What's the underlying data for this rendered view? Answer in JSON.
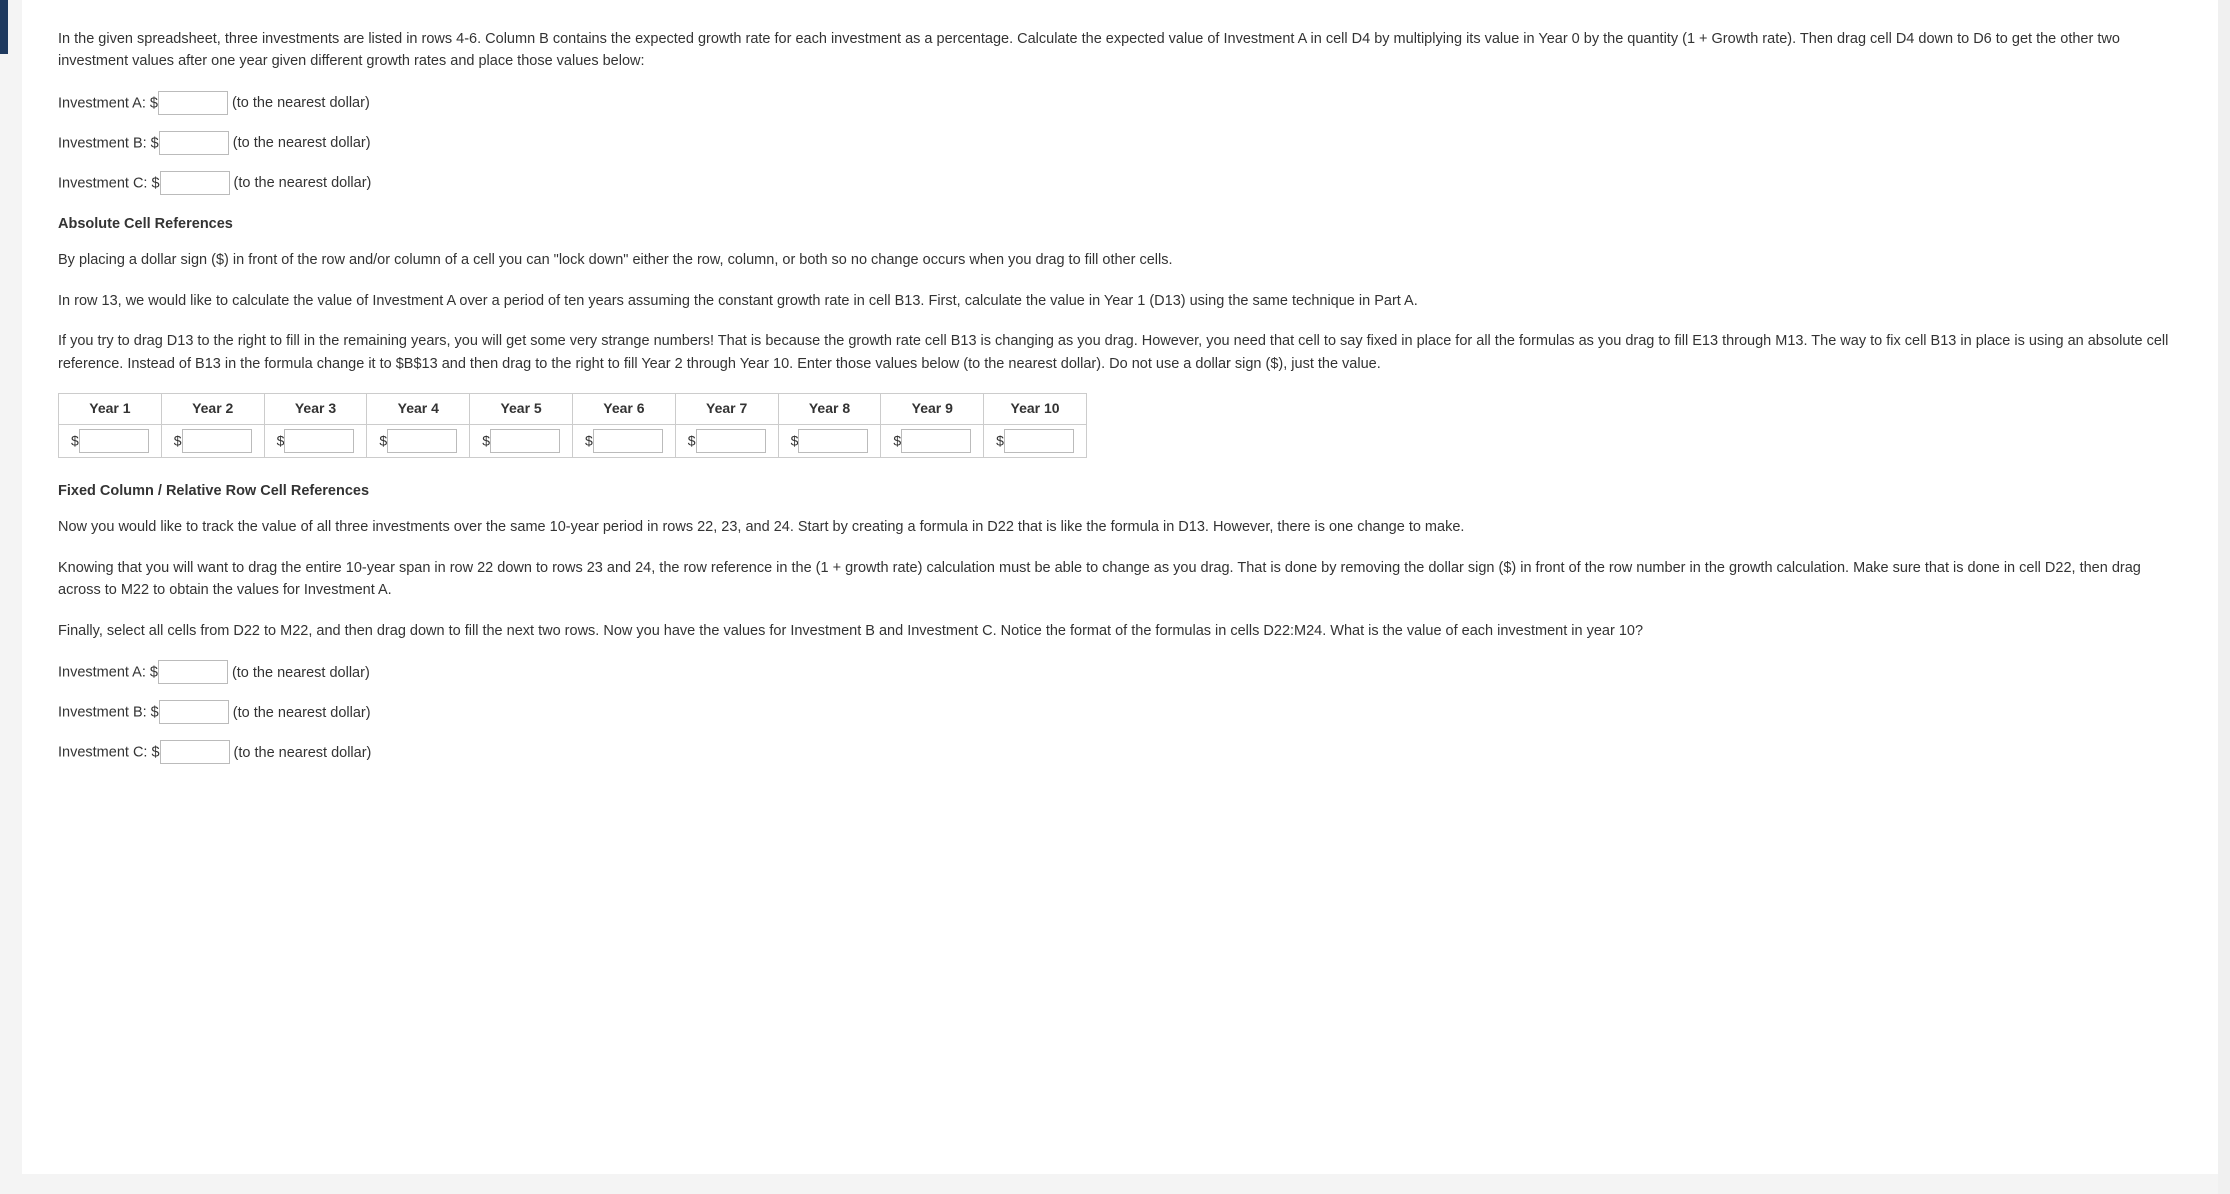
{
  "intro": "In the given spreadsheet, three investments are listed in rows 4-6. Column B contains the expected growth rate for each investment as a percentage. Calculate the expected value of Investment A in cell D4 by multiplying its value in Year 0 by the quantity (1 + Growth rate). Then drag cell D4 down to D6 to get the other two investment values after one year given different growth rates and place those values below:",
  "investments1": {
    "a": {
      "label": "Investment A: $",
      "suffix": "(to the nearest dollar)"
    },
    "b": {
      "label": "Investment B: $",
      "suffix": "(to the nearest dollar)"
    },
    "c": {
      "label": "Investment C: $",
      "suffix": "(to the nearest dollar)"
    }
  },
  "section_abs": {
    "title": "Absolute Cell References",
    "p1": "By placing a dollar sign ($) in front of the row and/or column of a cell you can \"lock down\" either the row, column, or both so no change occurs when you drag to fill other cells.",
    "p2": "In row 13, we would like to calculate the value of Investment A over a period of ten years assuming the constant growth rate in cell B13. First, calculate the value in Year 1 (D13) using the same technique in Part A.",
    "p3": "If you try to drag D13 to the right to fill in the remaining years, you will get some very strange numbers! That is because the growth rate cell B13 is changing as you drag. However, you need that cell to say fixed in place for all the formulas as you drag to fill E13 through M13. The way to fix cell B13 in place is using an absolute cell reference. Instead of B13 in the formula change it to $B$13 and then drag to the right to fill Year 2 through Year 10. Enter those values below (to the nearest dollar). Do not use a dollar sign ($), just the value."
  },
  "year_headers": [
    "Year 1",
    "Year 2",
    "Year 3",
    "Year 4",
    "Year 5",
    "Year 6",
    "Year 7",
    "Year 8",
    "Year 9",
    "Year 10"
  ],
  "dollar_sign": "$",
  "section_fixed": {
    "title": "Fixed Column / Relative Row Cell References",
    "p1": "Now you would like to track the value of all three investments over the same 10-year period in rows 22, 23, and 24. Start by creating a formula in D22 that is like the formula in D13. However, there is one change to make.",
    "p2": "Knowing that you will want to drag the entire 10-year span in row 22 down to rows 23 and 24, the row reference in the (1 + growth rate) calculation must be able to change as you drag. That is done by removing the dollar sign ($) in front of the row number in the growth calculation. Make sure that is done in cell D22, then drag across to M22 to obtain the values for Investment A.",
    "p3": "Finally, select all cells from D22 to M22, and then drag down to fill the next two rows. Now you have the values for Investment B and Investment C. Notice the format of the formulas in cells D22:M24. What is the value of each investment in year 10?"
  },
  "investments2": {
    "a": {
      "label": "Investment A: $",
      "suffix": "(to the nearest dollar)"
    },
    "b": {
      "label": "Investment B: $",
      "suffix": "(to the nearest dollar)"
    },
    "c": {
      "label": "Investment C: $",
      "suffix": "(to the nearest dollar)"
    }
  }
}
